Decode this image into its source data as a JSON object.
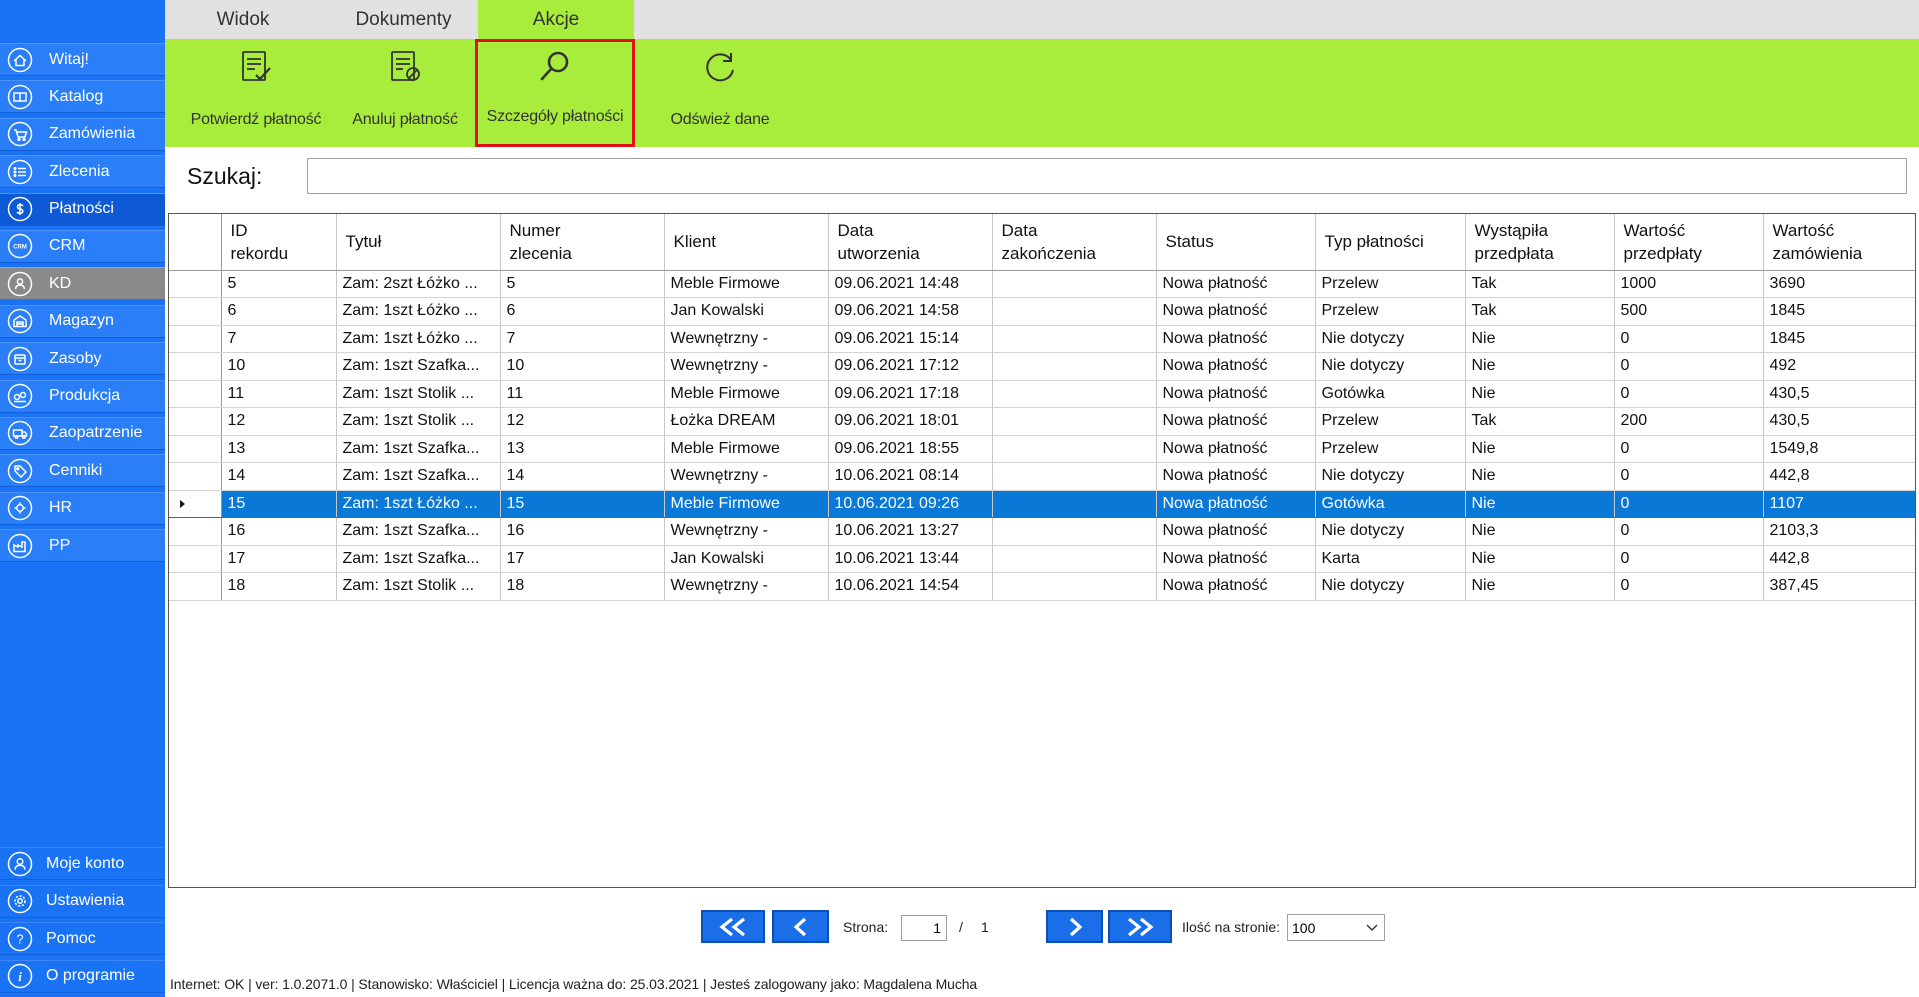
{
  "sidebar": {
    "items": [
      {
        "label": "Witaj!",
        "icon": "home-icon"
      },
      {
        "label": "Katalog",
        "icon": "book-icon"
      },
      {
        "label": "Zamówienia",
        "icon": "cart-icon"
      },
      {
        "label": "Zlecenia",
        "icon": "list-icon"
      },
      {
        "label": "Płatności",
        "icon": "dollar-icon"
      },
      {
        "label": "CRM",
        "icon": "crm-icon"
      },
      {
        "label": "KD",
        "icon": "user-icon"
      },
      {
        "label": "Magazyn",
        "icon": "warehouse-icon"
      },
      {
        "label": "Zasoby",
        "icon": "box-icon"
      },
      {
        "label": "Produkcja",
        "icon": "production-icon"
      },
      {
        "label": "Zaopatrzenie",
        "icon": "truck-icon"
      },
      {
        "label": "Cenniki",
        "icon": "tag-icon"
      },
      {
        "label": "HR",
        "icon": "hr-icon"
      },
      {
        "label": "PP",
        "icon": "factory-icon"
      }
    ],
    "bottom": [
      {
        "label": "Moje konto",
        "icon": "account-icon"
      },
      {
        "label": "Ustawienia",
        "icon": "gear-icon"
      },
      {
        "label": "Pomoc",
        "icon": "help-icon"
      },
      {
        "label": "O programie",
        "icon": "info-icon"
      }
    ]
  },
  "tabs": {
    "widok": "Widok",
    "dokumenty": "Dokumenty",
    "akcje": "Akcje"
  },
  "ribbon": {
    "confirm": "Potwierdź płatność",
    "cancel": "Anuluj płatność",
    "details": "Szczegóły płatności",
    "refresh": "Odśwież dane"
  },
  "search": {
    "label": "Szukaj:",
    "value": ""
  },
  "table": {
    "columns": [
      "ID\nrekordu",
      "Tytuł",
      "Numer\nzlecenia",
      "Klient",
      "Data\nutworzenia",
      "Data\nzakończenia",
      "Status",
      "Typ płatności",
      "Wystąpiła\nprzedpłata",
      "Wartość\nprzedpłaty",
      "Wartość\nzamówienia"
    ],
    "rows": [
      [
        "5",
        "Zam: 2szt Łóżko ...",
        "5",
        "Meble Firmowe",
        "09.06.2021 14:48",
        "",
        "Nowa płatność",
        "Przelew",
        "Tak",
        "1000",
        "3690"
      ],
      [
        "6",
        "Zam: 1szt Łóżko ...",
        "6",
        "Jan Kowalski",
        "09.06.2021 14:58",
        "",
        "Nowa płatność",
        "Przelew",
        "Tak",
        "500",
        "1845"
      ],
      [
        "7",
        "Zam: 1szt Łóżko ...",
        "7",
        "Wewnętrzny -",
        "09.06.2021 15:14",
        "",
        "Nowa płatność",
        "Nie dotyczy",
        "Nie",
        "0",
        "1845"
      ],
      [
        "10",
        "Zam: 1szt Szafka...",
        "10",
        "Wewnętrzny -",
        "09.06.2021 17:12",
        "",
        "Nowa płatność",
        "Nie dotyczy",
        "Nie",
        "0",
        "492"
      ],
      [
        "11",
        "Zam: 1szt Stolik ...",
        "11",
        "Meble Firmowe",
        "09.06.2021 17:18",
        "",
        "Nowa płatność",
        "Gotówka",
        "Nie",
        "0",
        "430,5"
      ],
      [
        "12",
        "Zam: 1szt Stolik ...",
        "12",
        "Łożka DREAM",
        "09.06.2021 18:01",
        "",
        "Nowa płatność",
        "Przelew",
        "Tak",
        "200",
        "430,5"
      ],
      [
        "13",
        "Zam: 1szt Szafka...",
        "13",
        "Meble Firmowe",
        "09.06.2021 18:55",
        "",
        "Nowa płatność",
        "Przelew",
        "Nie",
        "0",
        "1549,8"
      ],
      [
        "14",
        "Zam: 1szt Szafka...",
        "14",
        "Wewnętrzny -",
        "10.06.2021 08:14",
        "",
        "Nowa płatność",
        "Nie dotyczy",
        "Nie",
        "0",
        "442,8"
      ],
      [
        "15",
        "Zam: 1szt Łóżko ...",
        "15",
        "Meble Firmowe",
        "10.06.2021 09:26",
        "",
        "Nowa płatność",
        "Gotówka",
        "Nie",
        "0",
        "1107"
      ],
      [
        "16",
        "Zam: 1szt Szafka...",
        "16",
        "Wewnętrzny -",
        "10.06.2021 13:27",
        "",
        "Nowa płatność",
        "Nie dotyczy",
        "Nie",
        "0",
        "2103,3"
      ],
      [
        "17",
        "Zam: 1szt Szafka...",
        "17",
        "Jan Kowalski",
        "10.06.2021 13:44",
        "",
        "Nowa płatność",
        "Karta",
        "Nie",
        "0",
        "442,8"
      ],
      [
        "18",
        "Zam: 1szt Stolik ...",
        "18",
        "Wewnętrzny -",
        "10.06.2021 14:54",
        "",
        "Nowa płatność",
        "Nie dotyczy",
        "Nie",
        "0",
        "387,45"
      ]
    ],
    "selected_row": 8
  },
  "pager": {
    "page_label": "Strona:",
    "page": "1",
    "separator": "/",
    "total_pages": "1",
    "per_page_label": "Ilość na stronie:",
    "per_page": "100"
  },
  "statusbar": "Internet: OK  |   ver: 1.0.2071.0   |   Stanowisko: Właściciel    |   Licencja ważna do: 25.03.2021   |   Jesteś zalogowany jako: Magdalena Mucha",
  "colors": {
    "sidebar": "#1a73f5",
    "ribbon": "#a8ec3c",
    "highlight_border": "#e0111b",
    "selection": "#0a78d7",
    "pager_button": "#1a6fe8"
  }
}
